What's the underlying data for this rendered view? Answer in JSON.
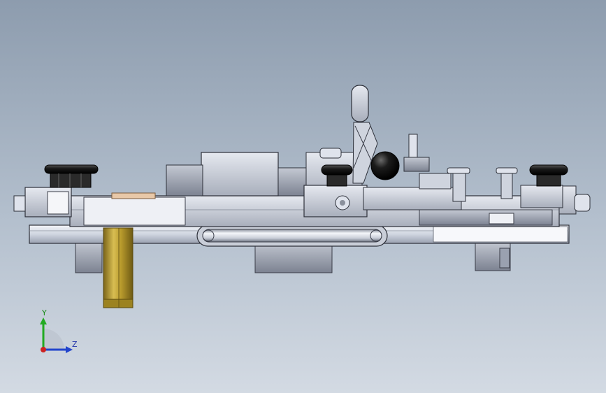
{
  "viewport": {
    "background_top": "#8d9cae",
    "background_bottom": "#d3dae3"
  },
  "colors": {
    "metal_light": "#dfe3ec",
    "metal_mid": "#b9bfcc",
    "metal_dark": "#7d8392",
    "edge": "#3a3d48",
    "brass": "#b89a2c",
    "brass_dark": "#7a6418",
    "knob_black": "#1a1a1a",
    "axis_x": "#cc2222",
    "axis_y": "#22aa22",
    "axis_z": "#2244cc"
  },
  "triad": {
    "y_label": "Y",
    "z_label": "Z"
  },
  "model": {
    "icon": "fixture-assembly-side-view",
    "parts": [
      "base-plate",
      "lower-frame",
      "guide-rod",
      "brass-pin",
      "toggle-clamp",
      "knob-left",
      "knob-center",
      "knob-right",
      "ball-knob",
      "end-blocks"
    ]
  }
}
